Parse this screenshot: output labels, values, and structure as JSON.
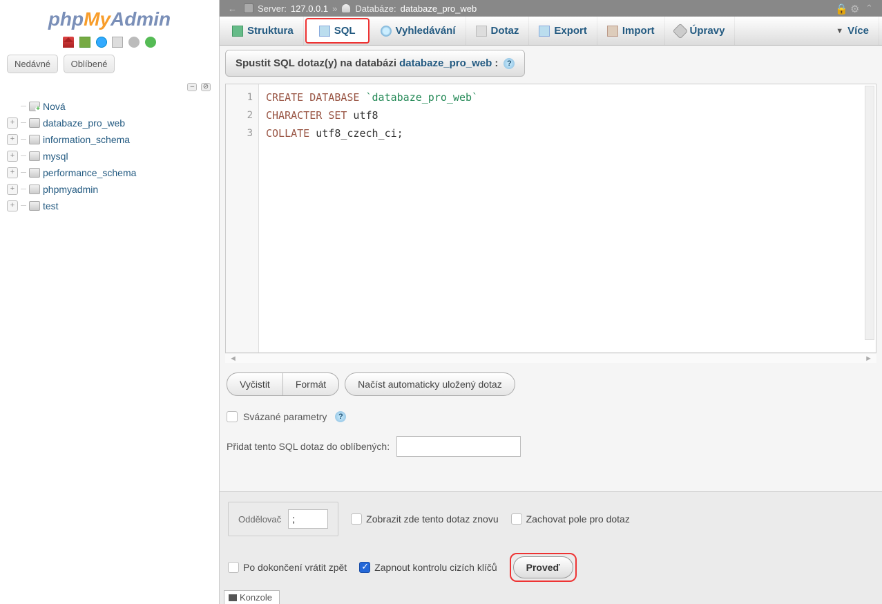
{
  "logo": {
    "php": "php",
    "my": "My",
    "admin": "Admin"
  },
  "sidebar": {
    "recent": "Nedávné",
    "favorite": "Oblíbené",
    "new_label": "Nová",
    "databases": [
      "databaze_pro_web",
      "information_schema",
      "mysql",
      "performance_schema",
      "phpmyadmin",
      "test"
    ]
  },
  "breadcrumb": {
    "server_label": "Server:",
    "server_value": "127.0.0.1",
    "separator": "»",
    "db_label": "Databáze:",
    "db_value": "databaze_pro_web"
  },
  "tabs": {
    "structure": "Struktura",
    "sql": "SQL",
    "search": "Vyhledávání",
    "query": "Dotaz",
    "export": "Export",
    "import": "Import",
    "operations": "Úpravy",
    "more": "Více"
  },
  "panel": {
    "run_prefix": "Spustit SQL dotaz(y) na databázi ",
    "db_name": "databaze_pro_web",
    "suffix": ":"
  },
  "editor": {
    "lines": [
      "1",
      "2",
      "3"
    ],
    "line1_kw1": "CREATE",
    "line1_kw2": "DATABASE",
    "line1_str": "`databaze_pro_web`",
    "line2_kw1": "CHARACTER",
    "line2_kw2": "SET",
    "line2_txt": " utf8",
    "line3_kw1": "COLLATE",
    "line3_txt": " utf8_czech_ci;"
  },
  "buttons": {
    "clear": "Vyčistit",
    "format": "Formát",
    "autosaved": "Načíst automaticky uložený dotaz"
  },
  "options": {
    "bind_params": "Svázané parametry",
    "bookmark_label": "Přidat tento SQL dotaz do oblíbených:"
  },
  "footer": {
    "delimiter_label": "Oddělovač",
    "delimiter_value": ";",
    "show_again": "Zobrazit zde tento dotaz znovu",
    "retain_box": "Zachovat pole pro dotaz",
    "rollback": "Po dokončení vrátit zpět",
    "fk_check": "Zapnout kontrolu cizích klíčů",
    "go": "Proveď",
    "console": "Konzole"
  }
}
